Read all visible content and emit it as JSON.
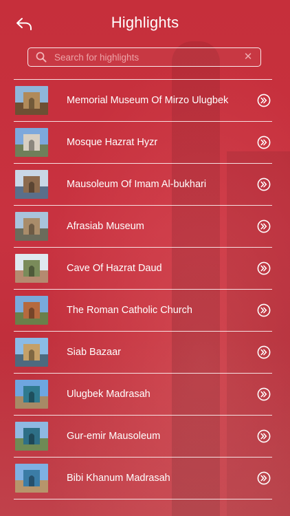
{
  "header": {
    "title": "Highlights",
    "back_icon": "back-arrow-icon"
  },
  "search": {
    "placeholder": "Search for highlights",
    "value": "",
    "search_icon": "search-icon",
    "clear_icon": "close-icon"
  },
  "colors": {
    "background": "#c62f3b",
    "text": "#ffffff",
    "divider": "#ffffff"
  },
  "items": [
    {
      "label": "Memorial Museum Of Mirzo Ulugbek",
      "thumb": [
        "#8fb6da",
        "#b08a5a",
        "#6d4f33"
      ]
    },
    {
      "label": "Mosque Hazrat Hyzr",
      "thumb": [
        "#7da8dc",
        "#d8cfc2",
        "#6f7f5a"
      ]
    },
    {
      "label": "Mausoleum Of Imam Al-bukhari",
      "thumb": [
        "#c9d7e6",
        "#8c6a4d",
        "#5a6f8a"
      ]
    },
    {
      "label": "Afrasiab Museum",
      "thumb": [
        "#a9c3dc",
        "#a98c6a",
        "#6b6b5b"
      ]
    },
    {
      "label": "Cave Of Hazrat Daud",
      "thumb": [
        "#dfe8ef",
        "#7a8b5a",
        "#b58a70"
      ]
    },
    {
      "label": "The Roman Catholic Church",
      "thumb": [
        "#79aadb",
        "#b56a3f",
        "#6a7f4a"
      ]
    },
    {
      "label": "Siab Bazaar",
      "thumb": [
        "#8bbbe6",
        "#c4a068",
        "#4d6a7f"
      ]
    },
    {
      "label": "Ulugbek Madrasah",
      "thumb": [
        "#6ea6e0",
        "#2f7a8f",
        "#a78a66"
      ]
    },
    {
      "label": "Gur-emir Mausoleum",
      "thumb": [
        "#8fb9e2",
        "#2e6f86",
        "#6f8a55"
      ]
    },
    {
      "label": "Bibi Khanum Madrasah",
      "thumb": [
        "#7fb0e3",
        "#3b7ca6",
        "#b7956b"
      ]
    }
  ],
  "row_chevron_icon": "chevron-right-circle-icon"
}
